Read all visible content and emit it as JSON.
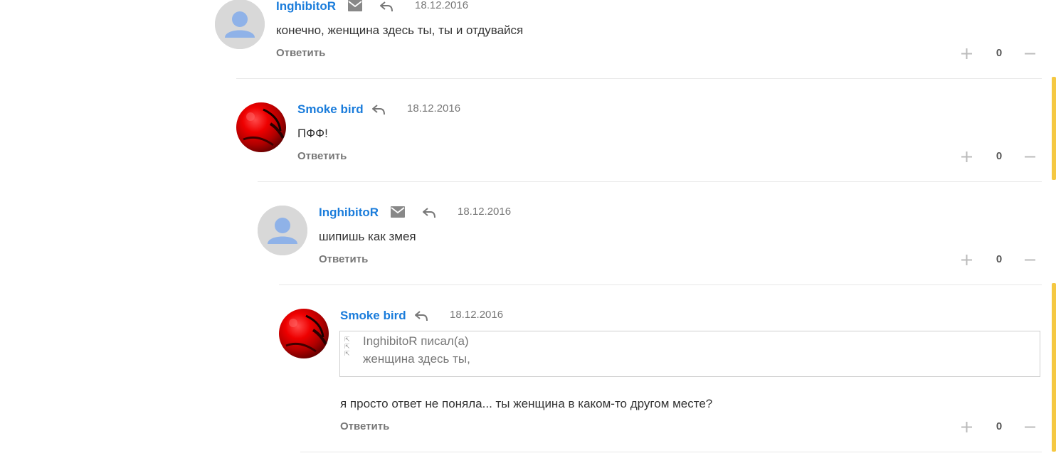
{
  "comments": [
    {
      "author": "InghibitoR",
      "date": "18.12.2016",
      "text": "конечно, женщина здесь ты, ты и отдувайся",
      "reply_label": "Ответить",
      "votes": "0"
    },
    {
      "author": "Smoke bird",
      "date": "18.12.2016",
      "text": "ПФФ!",
      "reply_label": "Ответить",
      "votes": "0"
    },
    {
      "author": "InghibitoR",
      "date": "18.12.2016",
      "text": "шипишь как змея",
      "reply_label": "Ответить",
      "votes": "0"
    },
    {
      "author": "Smoke bird",
      "date": "18.12.2016",
      "quote_author_line": "InghibitoR писал(а)",
      "quote_text": "женщина здесь ты,",
      "text": "я просто ответ не поняла... ты женщина в каком-то другом месте?",
      "reply_label": "Ответить",
      "votes": "0"
    }
  ],
  "icons": {
    "mail": "envelope-icon",
    "reply": "reply-arrow-icon",
    "plus": "plus-icon",
    "minus": "minus-icon",
    "avatar_default": "default-user-avatar",
    "avatar_red": "red-abstract-avatar"
  },
  "colors": {
    "author_link": "#1a7cdb",
    "accent_bar": "#f5c842",
    "date": "#777777",
    "divider": "#e8e8e8"
  }
}
